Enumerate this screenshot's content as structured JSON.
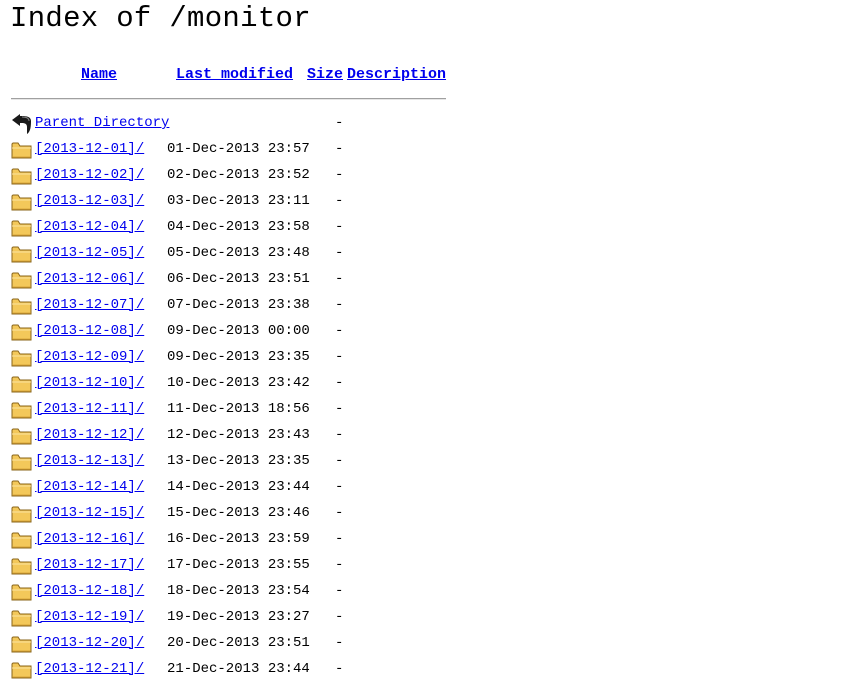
{
  "page": {
    "title": "Index of /monitor"
  },
  "columns": {
    "name": "Name",
    "last_modified": "Last modified",
    "size": "Size",
    "description": "Description"
  },
  "parent": {
    "label": "Parent Directory",
    "size": "-",
    "icon": "back-arrow-icon"
  },
  "entries": [
    {
      "name": "[2013-12-01]/",
      "modified": "01-Dec-2013 23:57",
      "size": "-",
      "icon": "folder-icon"
    },
    {
      "name": "[2013-12-02]/",
      "modified": "02-Dec-2013 23:52",
      "size": "-",
      "icon": "folder-icon"
    },
    {
      "name": "[2013-12-03]/",
      "modified": "03-Dec-2013 23:11",
      "size": "-",
      "icon": "folder-icon"
    },
    {
      "name": "[2013-12-04]/",
      "modified": "04-Dec-2013 23:58",
      "size": "-",
      "icon": "folder-icon"
    },
    {
      "name": "[2013-12-05]/",
      "modified": "05-Dec-2013 23:48",
      "size": "-",
      "icon": "folder-icon"
    },
    {
      "name": "[2013-12-06]/",
      "modified": "06-Dec-2013 23:51",
      "size": "-",
      "icon": "folder-icon"
    },
    {
      "name": "[2013-12-07]/",
      "modified": "07-Dec-2013 23:38",
      "size": "-",
      "icon": "folder-icon"
    },
    {
      "name": "[2013-12-08]/",
      "modified": "09-Dec-2013 00:00",
      "size": "-",
      "icon": "folder-icon"
    },
    {
      "name": "[2013-12-09]/",
      "modified": "09-Dec-2013 23:35",
      "size": "-",
      "icon": "folder-icon"
    },
    {
      "name": "[2013-12-10]/",
      "modified": "10-Dec-2013 23:42",
      "size": "-",
      "icon": "folder-icon"
    },
    {
      "name": "[2013-12-11]/",
      "modified": "11-Dec-2013 18:56",
      "size": "-",
      "icon": "folder-icon"
    },
    {
      "name": "[2013-12-12]/",
      "modified": "12-Dec-2013 23:43",
      "size": "-",
      "icon": "folder-icon"
    },
    {
      "name": "[2013-12-13]/",
      "modified": "13-Dec-2013 23:35",
      "size": "-",
      "icon": "folder-icon"
    },
    {
      "name": "[2013-12-14]/",
      "modified": "14-Dec-2013 23:44",
      "size": "-",
      "icon": "folder-icon"
    },
    {
      "name": "[2013-12-15]/",
      "modified": "15-Dec-2013 23:46",
      "size": "-",
      "icon": "folder-icon"
    },
    {
      "name": "[2013-12-16]/",
      "modified": "16-Dec-2013 23:59",
      "size": "-",
      "icon": "folder-icon"
    },
    {
      "name": "[2013-12-17]/",
      "modified": "17-Dec-2013 23:55",
      "size": "-",
      "icon": "folder-icon"
    },
    {
      "name": "[2013-12-18]/",
      "modified": "18-Dec-2013 23:54",
      "size": "-",
      "icon": "folder-icon"
    },
    {
      "name": "[2013-12-19]/",
      "modified": "19-Dec-2013 23:27",
      "size": "-",
      "icon": "folder-icon"
    },
    {
      "name": "[2013-12-20]/",
      "modified": "20-Dec-2013 23:51",
      "size": "-",
      "icon": "folder-icon"
    },
    {
      "name": "[2013-12-21]/",
      "modified": "21-Dec-2013 23:44",
      "size": "-",
      "icon": "folder-icon"
    }
  ],
  "colors": {
    "link": "#0000ee",
    "folder_fill": "#f3c85a",
    "folder_stroke": "#8a6418"
  }
}
